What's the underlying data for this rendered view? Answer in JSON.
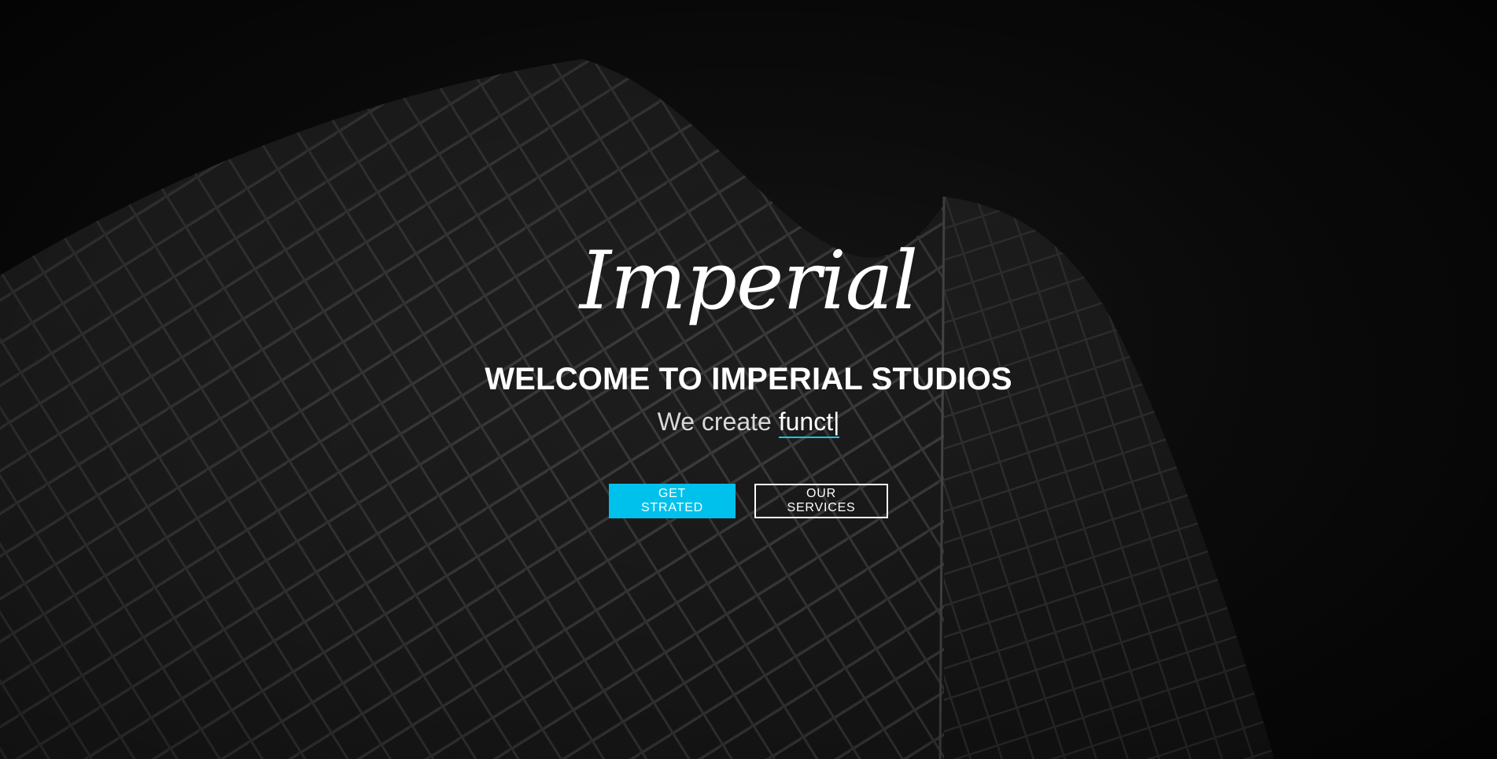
{
  "hero": {
    "logo_text": "Imperial",
    "headline": "WELCOME TO IMPERIAL STUDIOS",
    "tagline_prefix": "We create",
    "tagline_typed": "funct",
    "tagline_cursor": "|",
    "buttons": {
      "primary_label": "GET STRATED",
      "secondary_label": "OUR SERVICES"
    }
  },
  "colors": {
    "accent": "#00c1ec",
    "background": "#0b0b0b",
    "text": "#ffffff"
  }
}
